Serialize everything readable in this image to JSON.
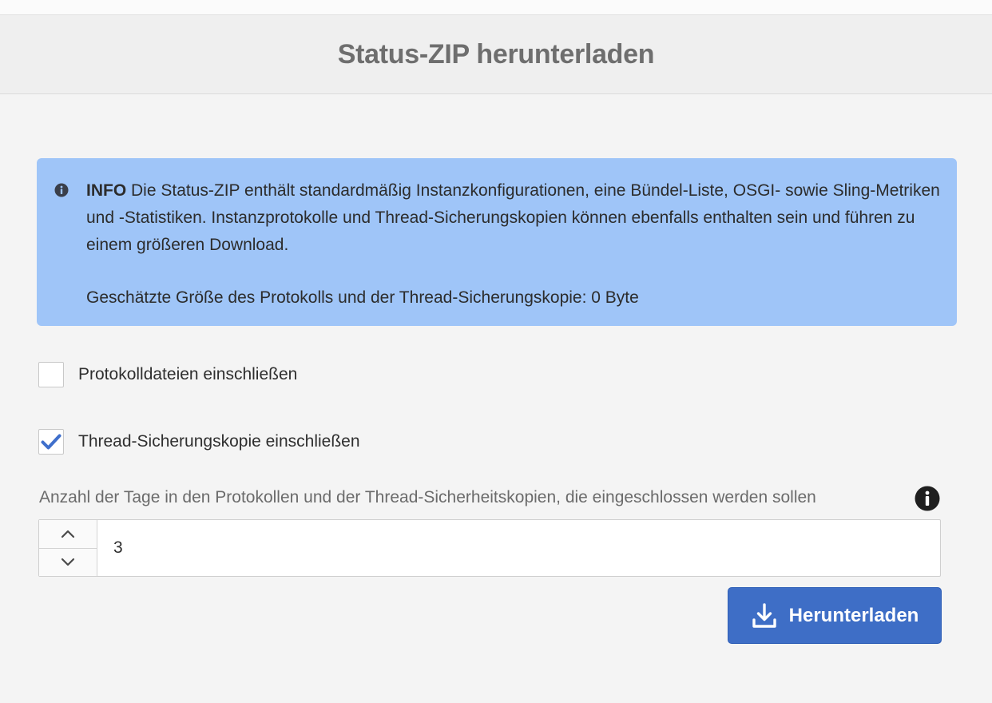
{
  "dialog": {
    "title": "Status-ZIP herunterladen"
  },
  "info": {
    "label": "INFO",
    "message": "Die Status-ZIP enthält standardmäßig Instanzkonfigurationen, eine Bündel-Liste, OSGI- sowie Sling-Metriken und -Statistiken. Instanzprotokolle und Thread-Sicherungskopien können ebenfalls enthalten sein und führen zu einem größeren Download.",
    "estimate": "Geschätzte Größe des Protokolls und der Thread-Sicherungskopie: 0 Byte",
    "icon": "info-circle-icon",
    "background_color": "#9fc5f8"
  },
  "options": {
    "include_logs": {
      "label": "Protokolldateien einschließen",
      "checked": false
    },
    "include_thread_dump": {
      "label": "Thread-Sicherungskopie einschließen",
      "checked": true
    }
  },
  "days": {
    "label": "Anzahl der Tage in den Protokollen und der Thread-Sicherheitskopien, die eingeschlossen werden sollen",
    "value": "3",
    "help_icon": "info-circle-icon",
    "increment_icon": "chevron-up-icon",
    "decrement_icon": "chevron-down-icon"
  },
  "actions": {
    "download_label": "Herunterladen",
    "download_icon": "download-icon",
    "accent_color": "#3e6ec6"
  }
}
